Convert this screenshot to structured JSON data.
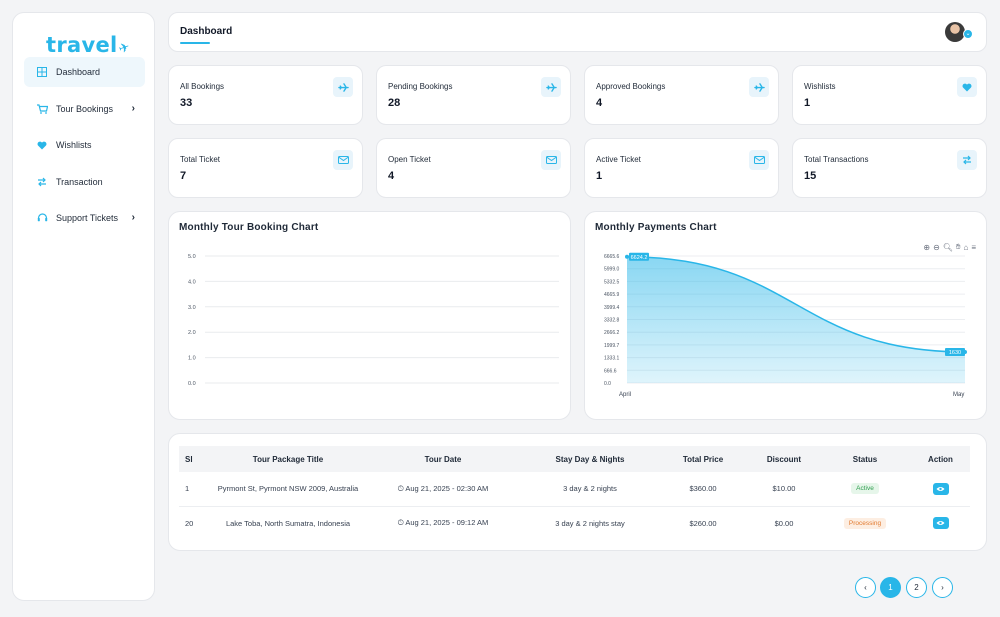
{
  "brand": {
    "logo_text": "travel",
    "accent_color": "#29b6e8"
  },
  "sidebar": {
    "items": [
      {
        "label": "Dashboard",
        "icon": "grid-icon",
        "active": true
      },
      {
        "label": "Tour Bookings",
        "icon": "cart-icon",
        "has_submenu": true
      },
      {
        "label": "Wishlists",
        "icon": "heart-icon"
      },
      {
        "label": "Transaction",
        "icon": "swap-icon"
      },
      {
        "label": "Support Tickets",
        "icon": "headset-icon",
        "has_submenu": true
      }
    ]
  },
  "header": {
    "title": "Dashboard"
  },
  "stats": [
    {
      "label": "All Bookings",
      "value": "33",
      "icon": "airplane-icon"
    },
    {
      "label": "Pending Bookings",
      "value": "28",
      "icon": "airplane-icon"
    },
    {
      "label": "Approved Bookings",
      "value": "4",
      "icon": "airplane-icon"
    },
    {
      "label": "Wishlists",
      "value": "1",
      "icon": "heart-icon"
    },
    {
      "label": "Total Ticket",
      "value": "7",
      "icon": "ticket-icon"
    },
    {
      "label": "Open Ticket",
      "value": "4",
      "icon": "ticket-icon"
    },
    {
      "label": "Active Ticket",
      "value": "1",
      "icon": "ticket-icon"
    },
    {
      "label": "Total Transactions",
      "value": "15",
      "icon": "swap-icon"
    }
  ],
  "chart_data": [
    {
      "type": "line",
      "title": "Monthly Tour Booking Chart",
      "yticks": [
        "5.0",
        "4.0",
        "3.0",
        "2.0",
        "1.0",
        "0.0"
      ],
      "ylim": [
        0,
        5
      ],
      "series": [],
      "grid": true
    },
    {
      "type": "area",
      "title": "Monthly Payments Chart",
      "x": [
        "April",
        "May"
      ],
      "y": [
        6624.2,
        1630
      ],
      "point_labels": [
        "6624.2",
        "1630"
      ],
      "yticks": [
        "6665.6",
        "5999.0",
        "5332.5",
        "4665.9",
        "3999.4",
        "3332.8",
        "2666.2",
        "1999.7",
        "1333.1",
        "666.6",
        "0.0"
      ],
      "ylim": [
        0,
        6665.6
      ],
      "grid": true,
      "color": "#29b6e8"
    }
  ],
  "table": {
    "headers": [
      "Sl",
      "Tour Package Title",
      "Tour Date",
      "Stay Day & Nights",
      "Total Price",
      "Discount",
      "Status",
      "Action"
    ],
    "rows": [
      {
        "sl": "1",
        "title": "Pyrmont St, Pyrmont NSW 2009, Australia",
        "date": "Aug 21, 2025 - 02:30 AM",
        "stay": "3 day & 2 nights",
        "price": "$360.00",
        "discount": "$10.00",
        "status": "Active",
        "status_kind": "active"
      },
      {
        "sl": "20",
        "title": "Lake Toba, North Sumatra, Indonesia",
        "date": "Aug 21, 2025 - 09:12 AM",
        "stay": "3 day & 2 nights stay",
        "price": "$260.00",
        "discount": "$0.00",
        "status": "Processing",
        "status_kind": "processing"
      }
    ]
  },
  "pagination": {
    "prev": "‹",
    "pages": [
      "1",
      "2"
    ],
    "current": "1",
    "next": "›"
  }
}
